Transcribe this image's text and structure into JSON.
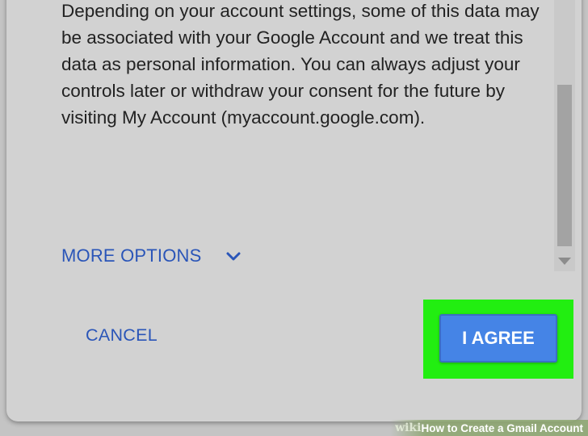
{
  "dialog": {
    "body_text": "Depending on your account settings, some of this data may be associated with your Google Account and we treat this data as personal information. You can always adjust your controls later or withdraw your consent for the future by visiting My Account (myaccount.google.com).",
    "more_options_label": "MORE OPTIONS",
    "cancel_label": "CANCEL",
    "agree_label": "I AGREE"
  },
  "watermark": {
    "wiki": "wiki",
    "how_to": "How to Create a Gmail Account"
  },
  "colors": {
    "link_blue": "#2a55b8",
    "agree_button": "#4584e6",
    "highlight_green": "#22ee11"
  }
}
